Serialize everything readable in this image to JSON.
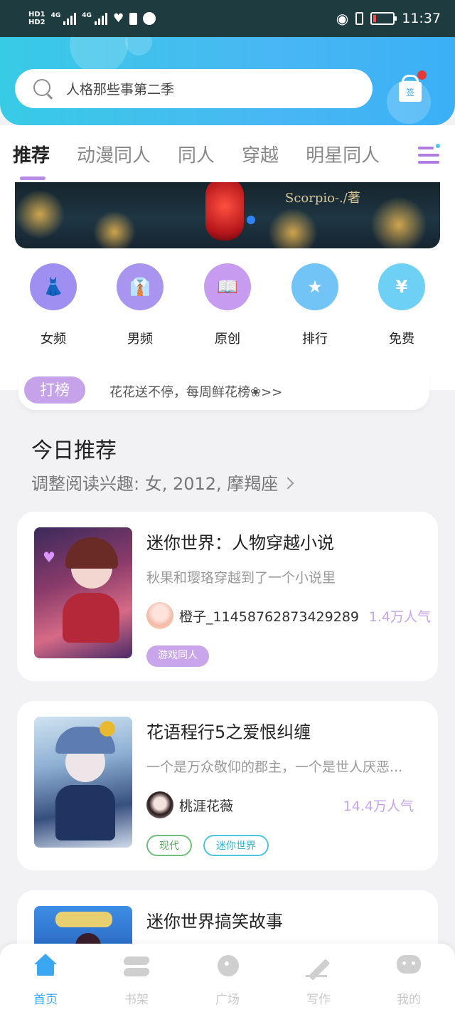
{
  "status_bar": {
    "hd_labels": [
      "HD1",
      "HD2"
    ],
    "network": [
      "4G",
      "4G"
    ],
    "time": "11:37",
    "battery_level": 0.1
  },
  "search": {
    "placeholder": "人格那些事第二季"
  },
  "signin": {
    "label": "签"
  },
  "tabs": [
    "推荐",
    "动漫同人",
    "同人",
    "穿越",
    "明星同人"
  ],
  "banner": {
    "credit": "Scorpio-./著"
  },
  "categories": [
    {
      "label": "女频",
      "icon": "dress-icon",
      "color": "#9f8ff0"
    },
    {
      "label": "男频",
      "icon": "shirt-icon",
      "color": "#a994f0"
    },
    {
      "label": "原创",
      "icon": "open-book-icon",
      "color": "#c79cf0"
    },
    {
      "label": "排行",
      "icon": "trophy-icon",
      "color": "#72c4f6"
    },
    {
      "label": "免费",
      "icon": "coin-icon",
      "color": "#6fd0f6"
    }
  ],
  "ranking": {
    "pill": "打榜",
    "text": "花花送不停，每周鲜花榜❀>>"
  },
  "today": {
    "title": "今日推荐",
    "subtitle": "调整阅读兴趣: 女, 2012, 摩羯座"
  },
  "books": [
    {
      "title": "迷你世界：人物穿越小说",
      "desc": "秋果和璎珞穿越到了一个小说里",
      "author": "橙子_11458762873429289",
      "popularity": "1.4万人气",
      "tags": [
        "游戏同人"
      ]
    },
    {
      "title": "花语程行5之爱恨纠缠",
      "desc": "一个是万众敬仰的郡主，一个是世人厌恶...",
      "author": "桃涯花薇",
      "popularity": "14.4万人气",
      "tags": [
        "现代",
        "迷你世界"
      ]
    },
    {
      "title": "迷你世界搞笑故事",
      "desc": "",
      "author": "",
      "popularity": "",
      "tags": []
    }
  ],
  "bottom_nav": [
    {
      "label": "首页",
      "icon": "home-icon",
      "active": true
    },
    {
      "label": "书架",
      "icon": "bookshelf-icon",
      "active": false
    },
    {
      "label": "广场",
      "icon": "planet-icon",
      "active": false
    },
    {
      "label": "写作",
      "icon": "pen-icon",
      "active": false
    },
    {
      "label": "我的",
      "icon": "chat-face-icon",
      "active": false
    }
  ],
  "colors": {
    "accent_purple": "#b58be6",
    "header_blue": "#49b7f3",
    "active_nav": "#3ba6f2",
    "tag_purple": "#c5a2e9",
    "tag_green": "#6fbf7a",
    "tag_cyan": "#4cc6e0"
  }
}
